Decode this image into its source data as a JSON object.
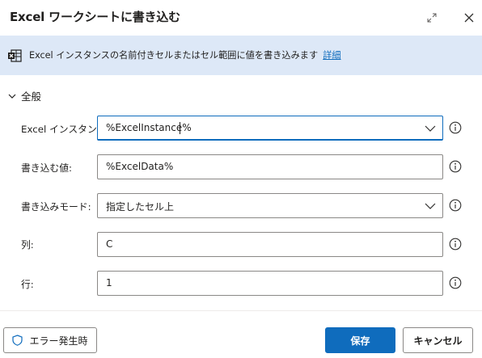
{
  "dialog": {
    "title": "Excel ワークシートに書き込む",
    "expand_icon": "expand-diagonal-icon",
    "close_icon": "close-icon"
  },
  "banner": {
    "icon": "excel-sheet-icon",
    "text": "Excel インスタンスの名前付きセルまたはセル範囲に値を書き込みます",
    "link": "詳細",
    "background": "#dde8f7",
    "link_color": "#0f6cbd"
  },
  "section": {
    "label": "全般",
    "icon": "chevron-down-icon"
  },
  "fields": {
    "excel_instance": {
      "label": "Excel インスタンス:",
      "value": "%ExcelInstance%"
    },
    "write_value": {
      "label": "書き込む値:",
      "value": "%ExcelData%"
    },
    "write_mode": {
      "label": "書き込みモード:",
      "value": "指定したセル上"
    },
    "column": {
      "label": "列:",
      "value": "C"
    },
    "row": {
      "label": "行:",
      "value": "1"
    }
  },
  "footer": {
    "on_error": "エラー発生時",
    "on_error_icon": "shield-icon",
    "save": "保存",
    "cancel": "キャンセル",
    "accent": "#0f6cbd"
  }
}
